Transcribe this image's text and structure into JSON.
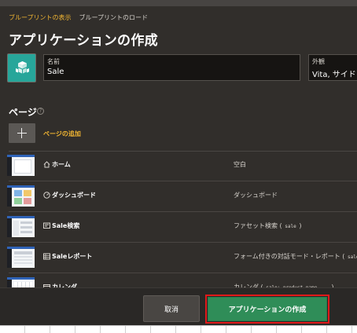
{
  "tabs": [
    {
      "label": "ブループリントの表示"
    },
    {
      "label": "ブループリントのロード"
    }
  ],
  "title": "アプリケーションの作成",
  "app_icon": {
    "icon": "cubes-icon",
    "color": "#27a69a"
  },
  "name_field": {
    "label": "名前",
    "value": "Sale"
  },
  "appearance_field": {
    "label": "外観",
    "value": "Vita, サイド・"
  },
  "pages": {
    "title": "ページ",
    "help": "?",
    "add_label": "ページの追加",
    "rows": [
      {
        "name": "ホーム",
        "icon": "home-icon",
        "type": "空白",
        "type_code": ""
      },
      {
        "name": "ダッシュボード",
        "icon": "gauge-icon",
        "type": "ダッシュボード",
        "type_code": ""
      },
      {
        "name": "Sale検索",
        "icon": "search-list-icon",
        "type": "ファセット検索 (",
        "type_code": " sale ",
        "type_suffix": ")"
      },
      {
        "name": "Saleレポート",
        "icon": "report-icon",
        "type": "フォーム付きの対話モード・レポート (",
        "type_code": " sale ",
        "type_suffix": ")"
      },
      {
        "name": "カレンダ",
        "icon": "calendar-icon",
        "type": "カレンダ (",
        "type_code": " sale: product_name ... ",
        "type_suffix": ")"
      }
    ]
  },
  "footer": {
    "cancel_label": "取消",
    "create_label": "アプリケーションの作成"
  },
  "colors": {
    "accent": "#f2b632",
    "primary": "#2f8d58",
    "highlight": "#e01a1a",
    "background": "#312e2b"
  }
}
